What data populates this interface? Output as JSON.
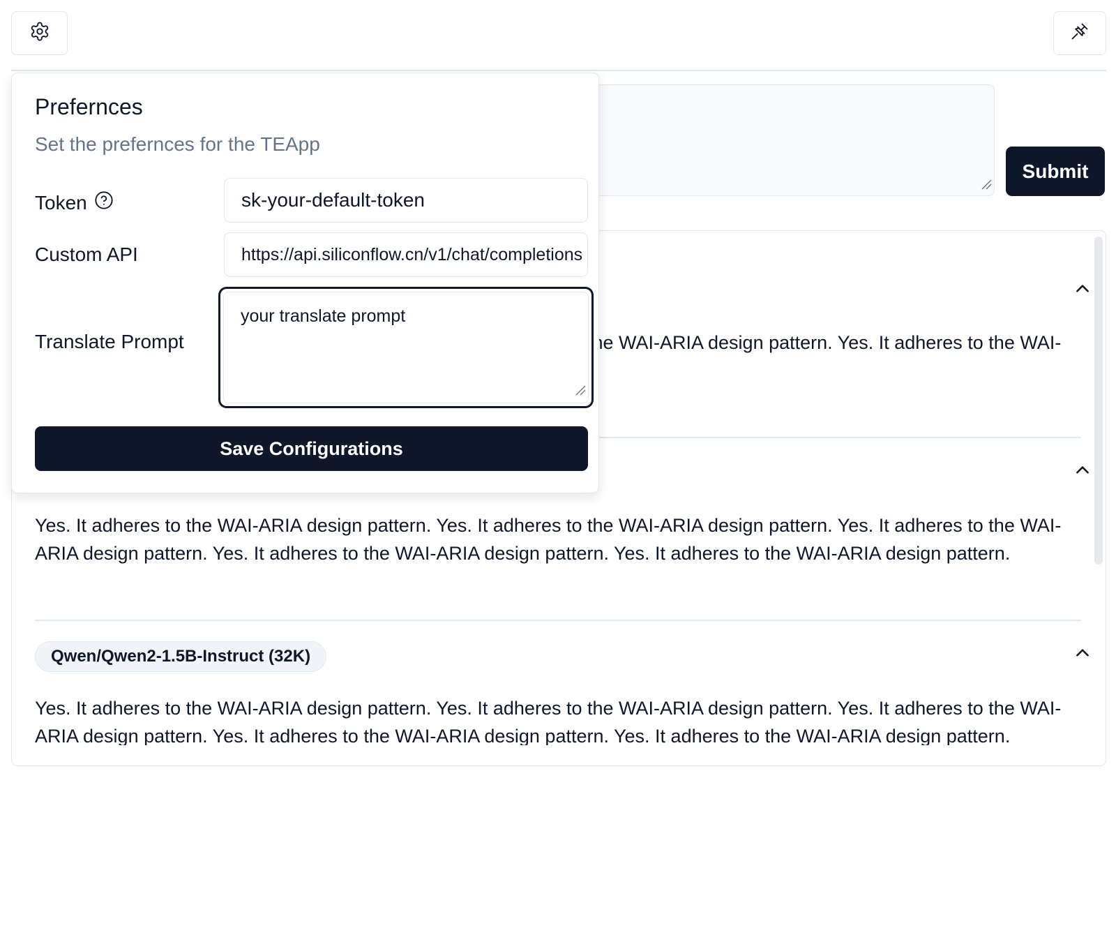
{
  "toolbar": {
    "settings_icon": "gear-icon",
    "pin_icon": "pin-icon",
    "submit_label": "Submit"
  },
  "preferences": {
    "title": "Prefernces",
    "subtitle": "Set the prefernces for the TEApp",
    "token_label": "Token",
    "token_value": "sk-your-default-token",
    "custom_api_label": "Custom API",
    "custom_api_value": "https://api.siliconflow.cn/v1/chat/completions",
    "translate_prompt_label": "Translate Prompt",
    "translate_prompt_value": "your translate prompt",
    "save_label": "Save Configurations"
  },
  "results": [
    {
      "model": "",
      "text_visible": "to the WAI-ARIA design pattern. Yes. It adheres to design pattern. Yes. It adheres to the WAI-ARIA"
    },
    {
      "model": "",
      "text": "Yes. It adheres to the WAI-ARIA design pattern. Yes. It adheres to the WAI-ARIA design pattern. Yes. It adheres to the WAI-ARIA design pattern. Yes. It adheres to the WAI-ARIA design pattern. Yes. It adheres to the WAI-ARIA design pattern."
    },
    {
      "model": "Qwen/Qwen2-1.5B-Instruct (32K)",
      "text": "Yes. It adheres to the WAI-ARIA design pattern. Yes. It adheres to the WAI-ARIA design pattern. Yes. It adheres to the WAI-ARIA design pattern. Yes. It adheres to the WAI-ARIA design pattern. Yes. It adheres to the WAI-ARIA design pattern."
    }
  ],
  "colors": {
    "primary": "#0f172a",
    "muted_text": "#64748b",
    "border": "#e2e8f0"
  }
}
